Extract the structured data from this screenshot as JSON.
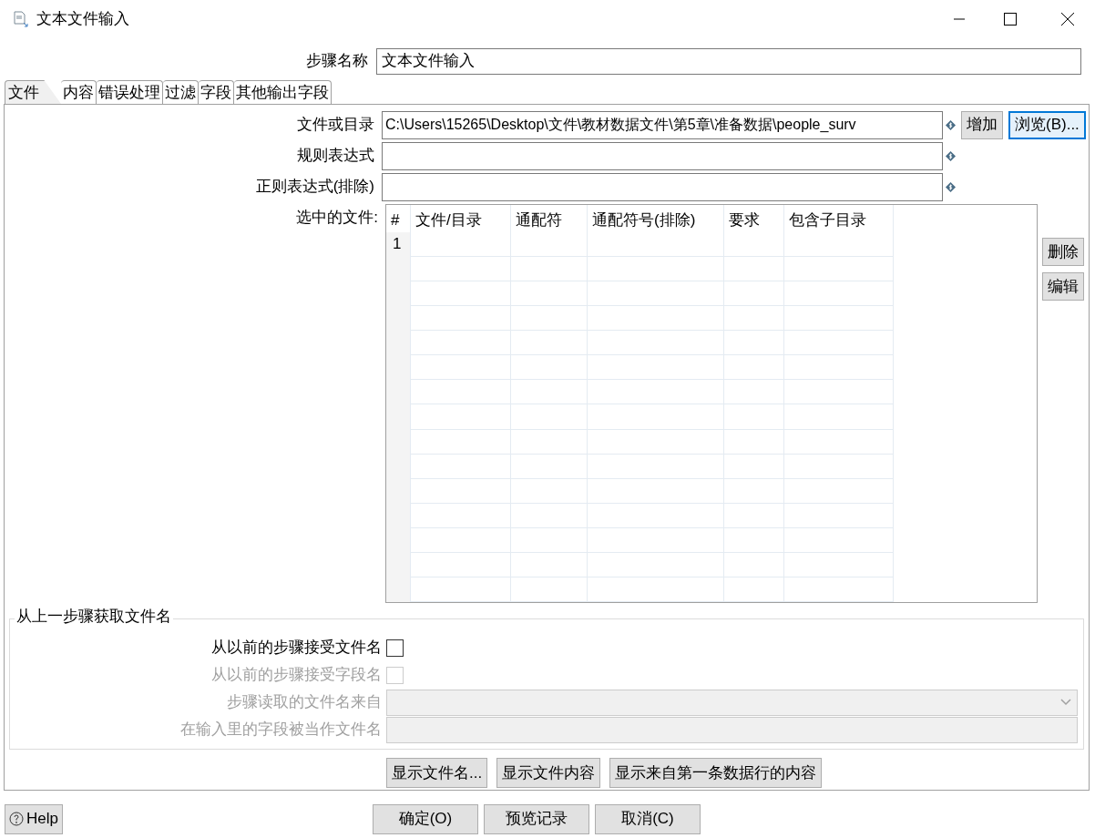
{
  "window": {
    "title": "文本文件输入"
  },
  "step_name": {
    "label": "步骤名称",
    "value": "文本文件输入"
  },
  "tabs": [
    {
      "label": "文件",
      "selected": true
    },
    {
      "label": "内容",
      "selected": false
    },
    {
      "label": "错误处理",
      "selected": false
    },
    {
      "label": "过滤",
      "selected": false
    },
    {
      "label": "字段",
      "selected": false
    },
    {
      "label": "其他输出字段",
      "selected": false
    }
  ],
  "file_fields": [
    {
      "label": "文件或目录",
      "value": "C:\\Users\\15265\\Desktop\\文件\\教材数据文件\\第5章\\准备数据\\people_surv"
    },
    {
      "label": "规则表达式"
    },
    {
      "label": "正则表达式(排除)"
    }
  ],
  "file_buttons": [
    {
      "label": "增加",
      "focused": false
    },
    {
      "label": "浏览(B)...",
      "focused": true
    }
  ],
  "selected_files": {
    "label": "选中的文件:",
    "columns": [
      "#",
      "文件/目录",
      "通配符",
      "通配符号(排除)",
      "要求",
      "包含子目录"
    ],
    "rows": [
      {
        "number": "1"
      }
    ],
    "buttons": [
      "删除",
      "编辑"
    ]
  },
  "previous_step": {
    "title": "从上一步骤获取文件名",
    "rows": [
      {
        "kind": "checkbox",
        "label": "从以前的步骤接受文件名",
        "checked": false,
        "disabled": false
      },
      {
        "kind": "checkbox",
        "label": "从以前的步骤接受字段名",
        "checked": false,
        "disabled": true
      },
      {
        "kind": "combo",
        "label": "步骤读取的文件名来自",
        "disabled": true
      },
      {
        "kind": "text",
        "label": "在输入里的字段被当作文件名",
        "disabled": true
      }
    ]
  },
  "action_buttons": [
    "显示文件名...",
    "显示文件内容",
    "显示来自第一条数据行的内容"
  ],
  "footer": {
    "help": "Help",
    "buttons": [
      "确定(O)",
      "预览记录",
      "取消(C)"
    ]
  }
}
